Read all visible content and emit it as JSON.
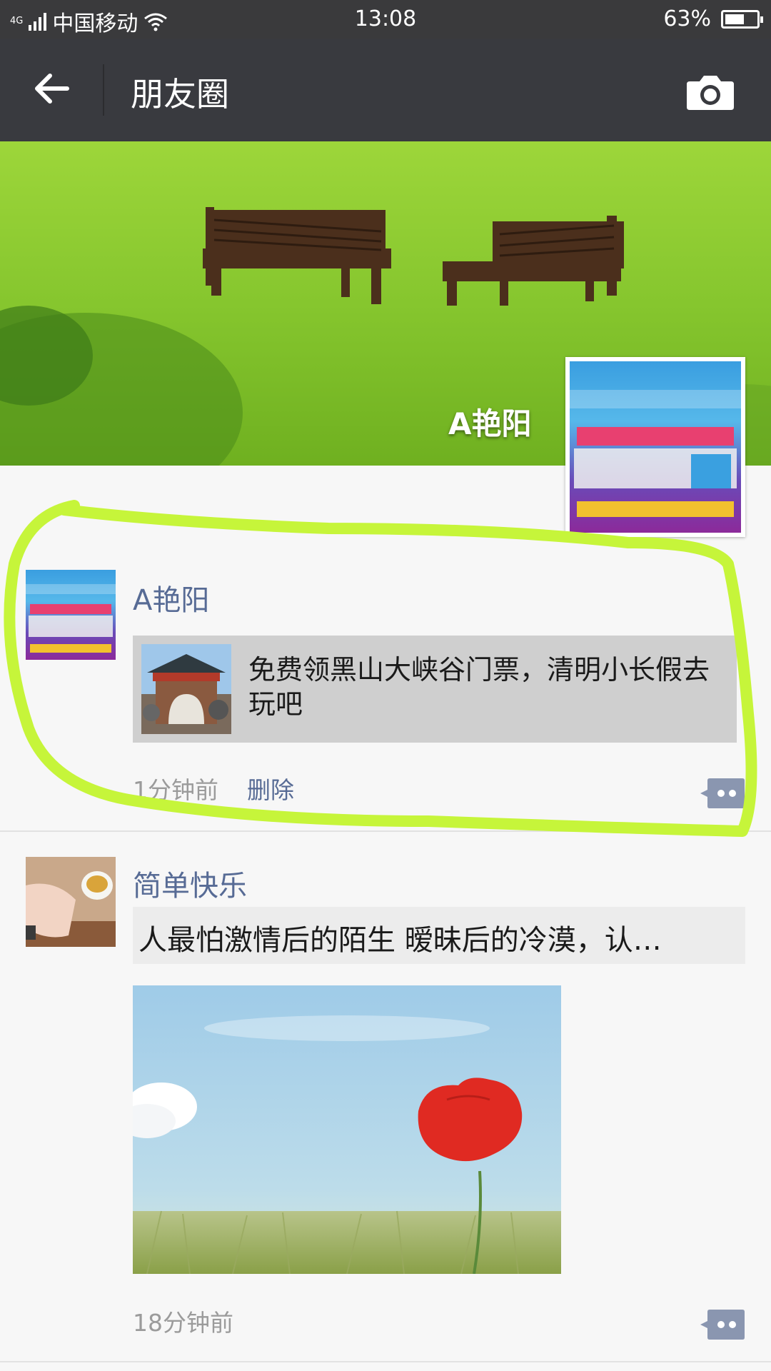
{
  "status_bar": {
    "network": "4G",
    "carrier": "中国移动",
    "time": "13:08",
    "battery": "63%",
    "battery_level": 0.63
  },
  "header": {
    "title": "朋友圈",
    "back_icon": "arrow-left-icon",
    "camera_icon": "camera-icon"
  },
  "cover": {
    "name": "A艳阳"
  },
  "posts": [
    {
      "name": "A艳阳",
      "link_text": "免费领黑山大峡谷门票，清明小长假去玩吧",
      "time": "1分钟前",
      "delete_label": "删除"
    },
    {
      "name": "简单快乐",
      "text": "人最怕激情后的陌生  暧昧后的冷漠，认…",
      "time": "18分钟前"
    }
  ],
  "colors": {
    "header_bg": "#393a3f",
    "status_bg": "#3a3a3c",
    "name_link": "#576b95",
    "annotation": "#c6f53a"
  }
}
